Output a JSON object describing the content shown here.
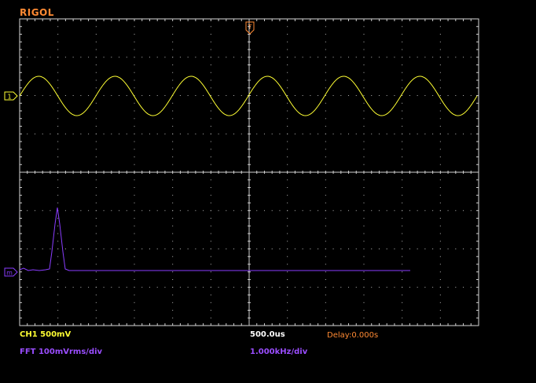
{
  "brand": "RIGOL",
  "colors": {
    "ch1": "#ffff33",
    "math": "#8a3dff",
    "trigger": "#ff8a33",
    "grid": "#cccccc",
    "background": "#000000"
  },
  "markers": {
    "ch1": "1",
    "math": "m",
    "trigger": "T"
  },
  "status": {
    "ch1_scale": "CH1 500mV",
    "timebase": "500.0us",
    "delay": "Delay:0.000s",
    "fft_scale": "FFT 100mVrms/div",
    "fft_span": "1.000kHz/div"
  },
  "waveforms": {
    "ch1": {
      "type": "sine",
      "cycles_on_screen": 6
    },
    "fft": {
      "type": "spectrum",
      "peak_bin_div": 0.5
    }
  }
}
